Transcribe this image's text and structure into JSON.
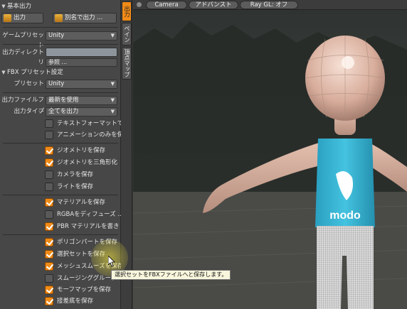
{
  "panel": {
    "section_title": "基本出力",
    "export_button": "出力",
    "export_as_button": "別名で出力 ...",
    "game_preset_label": "ゲームプリセット",
    "game_preset_value": "Unity",
    "output_dir_label": "出力ディレクトリ",
    "output_dir_value": "",
    "browse_button": "参照 ...",
    "fbx_section": "FBX プリセット設定",
    "preset_label": "プリセット",
    "preset_value": "Unity",
    "output_file_label": "出力ファイルフ ...",
    "output_file_value": "最新を使用",
    "output_type_label": "出力タイプ",
    "output_type_value": "全てを出力",
    "options": [
      {
        "label": "テキストフォーマットで ...",
        "checked": false
      },
      {
        "label": "アニメーションのみを保存",
        "checked": false
      },
      {
        "label": "ジオメトリを保存",
        "checked": true
      },
      {
        "label": "ジオメトリを三角形化",
        "checked": true
      },
      {
        "label": "カメラを保存",
        "checked": false
      },
      {
        "label": "ライトを保存",
        "checked": false
      },
      {
        "label": "マテリアルを保存",
        "checked": true
      },
      {
        "label": "RGBAをディフューズ ...",
        "checked": false
      },
      {
        "label": "PBR マテリアルを書き ...",
        "checked": true
      },
      {
        "label": "ポリゴンパートを保存",
        "checked": true
      },
      {
        "label": "選択セットを保存",
        "checked": true
      },
      {
        "label": "メッシュスムーズを保存",
        "checked": true
      },
      {
        "label": "スムージンググループ",
        "checked": false
      },
      {
        "label": "モーフマップを保存",
        "checked": true
      },
      {
        "label": "接差底を保存",
        "checked": true
      }
    ]
  },
  "vtabs": [
    "出力",
    "ペイン",
    "頂点マップ"
  ],
  "viewport": {
    "tabs": [
      "Camera",
      "アドバンスト",
      "Ray GL: オフ"
    ],
    "tooltip": "選択セットをFBXファイルへと保存します。",
    "logo_text": "modo"
  },
  "colors": {
    "accent": "#f18b17",
    "panel_bg": "#474747",
    "tooltip_bg": "#f8f6dc"
  }
}
